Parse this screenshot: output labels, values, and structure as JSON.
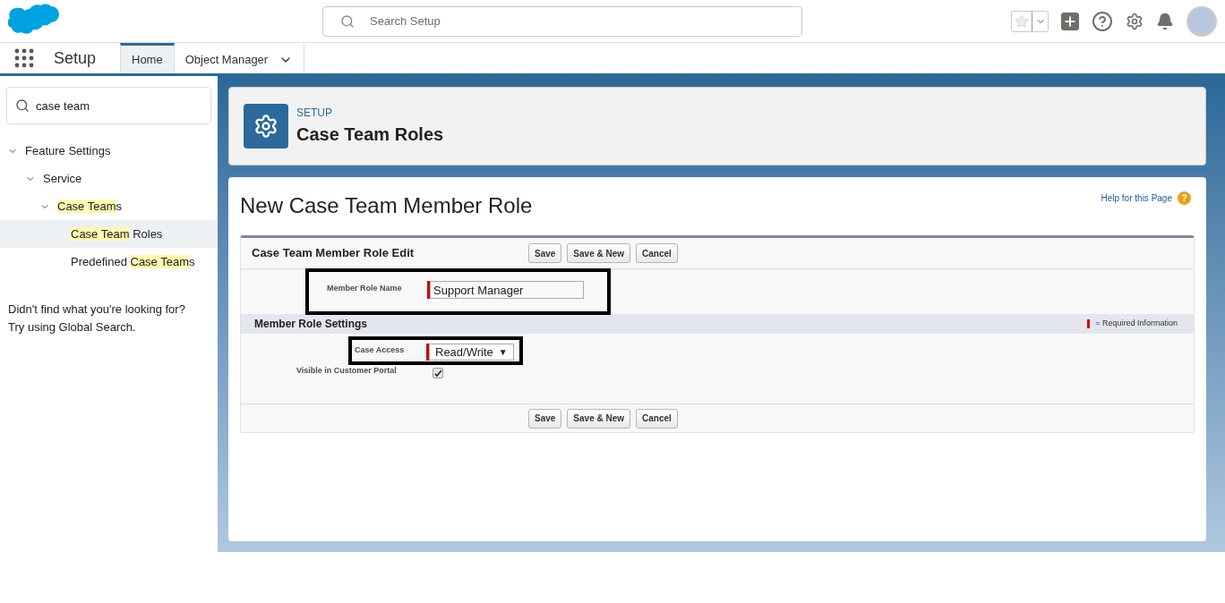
{
  "header": {
    "search": {
      "placeholder": "Search Setup"
    }
  },
  "nav": {
    "app_name": "Setup",
    "tabs": [
      {
        "label": "Home",
        "selected": true,
        "has_menu": false
      },
      {
        "label": "Object Manager",
        "selected": false,
        "has_menu": true
      }
    ]
  },
  "sidebar": {
    "search": {
      "value": "case team"
    },
    "tree": [
      {
        "parts": [
          {
            "text": "Feature Settings",
            "highlight": false
          }
        ],
        "expanded": true,
        "selected": false,
        "children": [
          {
            "parts": [
              {
                "text": "Service",
                "highlight": false
              }
            ],
            "expanded": true,
            "selected": false,
            "children": [
              {
                "parts": [
                  {
                    "text": "Case Team",
                    "highlight": true
                  },
                  {
                    "text": "s",
                    "highlight": false
                  }
                ],
                "expanded": true,
                "selected": false,
                "children": [
                  {
                    "parts": [
                      {
                        "text": "Case Team",
                        "highlight": true
                      },
                      {
                        "text": " Roles",
                        "highlight": false
                      }
                    ],
                    "selected": true
                  },
                  {
                    "parts": [
                      {
                        "text": "Predefined ",
                        "highlight": false
                      },
                      {
                        "text": "Case Team",
                        "highlight": true
                      },
                      {
                        "text": "s",
                        "highlight": false
                      }
                    ],
                    "selected": false
                  }
                ]
              }
            ]
          }
        ]
      }
    ],
    "hint": [
      "Didn't find what you're looking for?",
      "Try using Global Search."
    ]
  },
  "page_header": {
    "eyebrow": "SETUP",
    "title": "Case Team Roles"
  },
  "form": {
    "title": "New Case Team Member Role",
    "help_link": "Help for this Page",
    "help_icon": "?",
    "section_title": "Case Team Member Role Edit",
    "buttons": [
      "Save",
      "Save & New",
      "Cancel"
    ],
    "name_field": {
      "label": "Member Role Name",
      "value": "Support Manager",
      "required": true,
      "annotated": true
    },
    "settings_title": "Member Role Settings",
    "required_legend": "= Required Information",
    "access_field": {
      "label": "Case Access",
      "value": "Read/Write",
      "caret": "▼",
      "required": true,
      "annotated": true
    },
    "portal_field": {
      "label": "Visible in Customer Portal",
      "checked": true
    },
    "bottom_buttons": [
      "Save",
      "Save & New",
      "Cancel"
    ]
  }
}
